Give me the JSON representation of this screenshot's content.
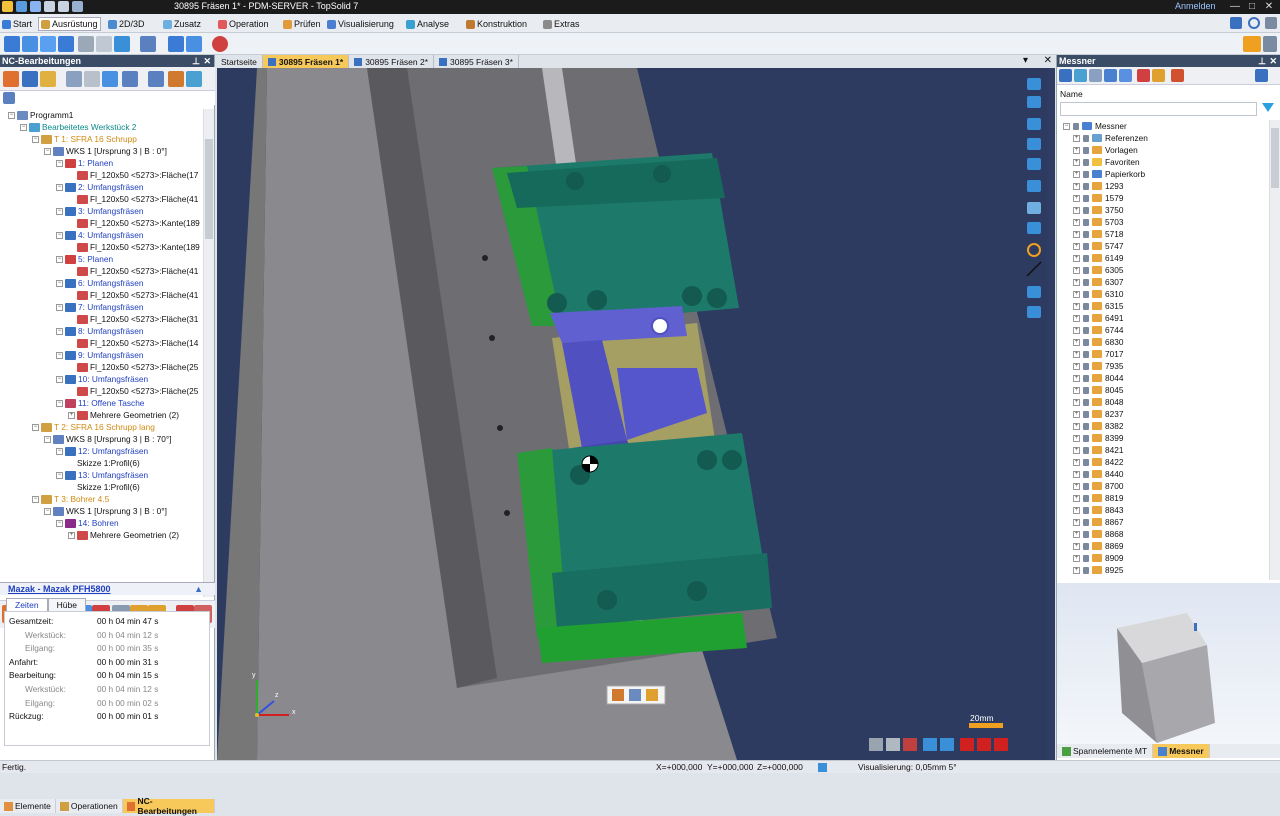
{
  "titlebar": {
    "document": "30895 Fräsen 1* - PDM-SERVER",
    "app": "TopSolid 7",
    "login": "Anmelden",
    "window_controls": [
      "—",
      "□",
      "✕"
    ]
  },
  "menubar": {
    "items": [
      "Start",
      "Ausrüstung",
      "2D/3D",
      "Zusatz",
      "Operation",
      "Prüfen",
      "Visualisierung",
      "Analyse",
      "Konstruktion",
      "Extras"
    ]
  },
  "left_panel": {
    "title": "NC-Bearbeitungen",
    "tree": [
      {
        "level": 0,
        "text": "Programm1",
        "color": "black",
        "icon": "program-icon",
        "expander": "−"
      },
      {
        "level": 1,
        "text": "Bearbeitetes Werkstück 2",
        "color": "teal",
        "icon": "workpiece-icon",
        "expander": "−"
      },
      {
        "level": 2,
        "text": "T 1: SFRA 16 Schrupp",
        "color": "orange",
        "icon": "tool-icon",
        "expander": "−"
      },
      {
        "level": 3,
        "text": "WKS 1 [Ursprung 3 | B : 0°]",
        "color": "black",
        "icon": "frame-icon",
        "expander": "−"
      },
      {
        "level": 4,
        "text": "1: Planen",
        "color": "blue",
        "icon": "facing-icon",
        "expander": "−"
      },
      {
        "level": 5,
        "text": "Fl_120x50 <5273>:Fläche(17",
        "color": "black",
        "icon": "face-icon",
        "expander": ""
      },
      {
        "level": 4,
        "text": "2: Umfangsfräsen",
        "color": "blue",
        "icon": "contour-icon",
        "expander": "−"
      },
      {
        "level": 5,
        "text": "Fl_120x50 <5273>:Fläche(41",
        "color": "black",
        "icon": "face-icon",
        "expander": ""
      },
      {
        "level": 4,
        "text": "3: Umfangsfräsen",
        "color": "blue",
        "icon": "contour-icon",
        "expander": "−"
      },
      {
        "level": 5,
        "text": "Fl_120x50 <5273>:Kante(189",
        "color": "black",
        "icon": "face-icon",
        "expander": ""
      },
      {
        "level": 4,
        "text": "4: Umfangsfräsen",
        "color": "blue",
        "icon": "contour-icon",
        "expander": "−"
      },
      {
        "level": 5,
        "text": "Fl_120x50 <5273>:Kante(189",
        "color": "black",
        "icon": "face-icon",
        "expander": ""
      },
      {
        "level": 4,
        "text": "5: Planen",
        "color": "blue",
        "icon": "facing-icon",
        "expander": "−"
      },
      {
        "level": 5,
        "text": "Fl_120x50 <5273>:Fläche(41",
        "color": "black",
        "icon": "face-icon",
        "expander": ""
      },
      {
        "level": 4,
        "text": "6: Umfangsfräsen",
        "color": "blue",
        "icon": "contour-icon",
        "expander": "−"
      },
      {
        "level": 5,
        "text": "Fl_120x50 <5273>:Fläche(41",
        "color": "black",
        "icon": "face-icon",
        "expander": ""
      },
      {
        "level": 4,
        "text": "7: Umfangsfräsen",
        "color": "blue",
        "icon": "contour-icon",
        "expander": "−"
      },
      {
        "level": 5,
        "text": "Fl_120x50 <5273>:Fläche(31",
        "color": "black",
        "icon": "face-icon",
        "expander": ""
      },
      {
        "level": 4,
        "text": "8: Umfangsfräsen",
        "color": "blue",
        "icon": "contour-icon",
        "expander": "−"
      },
      {
        "level": 5,
        "text": "Fl_120x50 <5273>:Fläche(14",
        "color": "black",
        "icon": "face-icon",
        "expander": ""
      },
      {
        "level": 4,
        "text": "9: Umfangsfräsen",
        "color": "blue",
        "icon": "contour-icon",
        "expander": "−"
      },
      {
        "level": 5,
        "text": "Fl_120x50 <5273>:Fläche(25",
        "color": "black",
        "icon": "face-icon",
        "expander": ""
      },
      {
        "level": 4,
        "text": "10: Umfangsfräsen",
        "color": "blue",
        "icon": "contour-icon",
        "expander": "−"
      },
      {
        "level": 5,
        "text": "Fl_120x50 <5273>:Fläche(25",
        "color": "black",
        "icon": "face-icon",
        "expander": ""
      },
      {
        "level": 4,
        "text": "11: Offene Tasche",
        "color": "blue",
        "icon": "pocket-icon",
        "expander": "−"
      },
      {
        "level": 5,
        "text": "Mehrere Geometrien (2)",
        "color": "black",
        "icon": "face-icon",
        "expander": "+"
      },
      {
        "level": 2,
        "text": "T 2: SFRA 16 Schrupp lang",
        "color": "orange",
        "icon": "tool-icon",
        "expander": "−"
      },
      {
        "level": 3,
        "text": "WKS 8 [Ursprung 3 | B : 70°]",
        "color": "black",
        "icon": "frame-icon",
        "expander": "−"
      },
      {
        "level": 4,
        "text": "12: Umfangsfräsen",
        "color": "blue",
        "icon": "contour-icon",
        "expander": "−"
      },
      {
        "level": 5,
        "text": "Skizze 1:Profil(6)",
        "color": "black",
        "icon": "",
        "expander": ""
      },
      {
        "level": 4,
        "text": "13: Umfangsfräsen",
        "color": "blue",
        "icon": "contour-icon",
        "expander": "−"
      },
      {
        "level": 5,
        "text": "Skizze 1:Profil(6)",
        "color": "black",
        "icon": "",
        "expander": ""
      },
      {
        "level": 2,
        "text": "T 3: Bohrer 4.5",
        "color": "orange",
        "icon": "tool-icon",
        "expander": "−"
      },
      {
        "level": 3,
        "text": "WKS 1 [Ursprung 3 | B : 0°]",
        "color": "black",
        "icon": "frame-icon",
        "expander": "−"
      },
      {
        "level": 4,
        "text": "14: Bohren",
        "color": "blue",
        "icon": "drill-icon",
        "expander": "−"
      },
      {
        "level": 5,
        "text": "Mehrere Geometrien (2)",
        "color": "black",
        "icon": "face-icon",
        "expander": "+"
      }
    ],
    "machine": "Mazak - Mazak PFH5800",
    "tabs": [
      "Zeiten",
      "Hübe"
    ],
    "times": [
      {
        "label": "Gesamtzeit:",
        "value": "00 h 04 min 47 s",
        "sub": false
      },
      {
        "label": "Werkstück:",
        "value": "00 h 04 min 12 s",
        "sub": true
      },
      {
        "label": "Eilgang:",
        "value": "00 h 00 min 35 s",
        "sub": true
      },
      {
        "label": "Anfahrt:",
        "value": "00 h 00 min 31 s",
        "sub": false
      },
      {
        "label": "Bearbeitung:",
        "value": "00 h 04 min 15 s",
        "sub": false
      },
      {
        "label": "Werkstück:",
        "value": "00 h 04 min 12 s",
        "sub": true
      },
      {
        "label": "Eilgang:",
        "value": "00 h 00 min 02 s",
        "sub": true
      },
      {
        "label": "Rückzug:",
        "value": "00 h 00 min 01 s",
        "sub": false
      }
    ],
    "bottom_tabs": [
      "Elemente",
      "Operationen",
      "NC-Bearbeitungen"
    ]
  },
  "doc_tabs": [
    "Startseite",
    "30895 Fräsen 1*",
    "30895 Fräsen 2*",
    "30895 Fräsen 3*"
  ],
  "viewport": {
    "scale_label": "20mm",
    "axis_labels": [
      "x",
      "y",
      "z"
    ]
  },
  "right_panel": {
    "title": "Messner",
    "column": "Name",
    "root": "Messner",
    "special": [
      "Referenzen",
      "Vorlagen",
      "Favoriten",
      "Papierkorb"
    ],
    "folders": [
      "1293",
      "1579",
      "3750",
      "5703",
      "5718",
      "5747",
      "6149",
      "6305",
      "6307",
      "6310",
      "6315",
      "6491",
      "6744",
      "6830",
      "7017",
      "7935",
      "8044",
      "8045",
      "8048",
      "8237",
      "8382",
      "8399",
      "8421",
      "8422",
      "8440",
      "8700",
      "8819",
      "8843",
      "8867",
      "8868",
      "8869",
      "8909",
      "8925"
    ],
    "bottom_tabs": [
      "Spannelemente MT",
      "Messner"
    ]
  },
  "statusbar": {
    "left": "Fertig.",
    "x": "X=+000,000",
    "y": "Y=+000,000",
    "z": "Z=+000,000",
    "vis": "Visualisierung: 0,05mm 5°"
  },
  "colors": {
    "accent": "#f7c85a",
    "panel_header": "#3b4d66",
    "viewport_bg": "#2f3d64",
    "fixture_green": "#1d7a6a",
    "part_purple": "#5555cc"
  }
}
